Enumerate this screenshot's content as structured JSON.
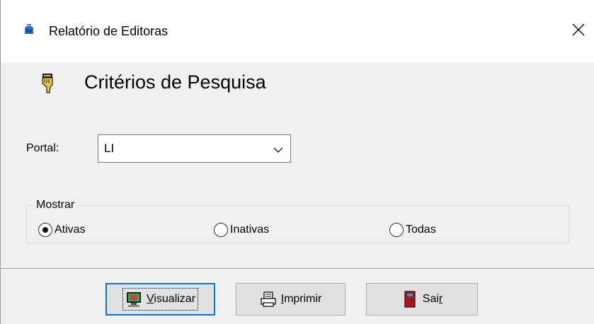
{
  "window": {
    "title": "Relatório de Editoras",
    "close_glyph": "✕"
  },
  "header": {
    "title": "Critérios de Pesquisa",
    "icon": "hand-pointing-icon"
  },
  "form": {
    "portal_label": "Portal:",
    "portal_value": "LI"
  },
  "filter": {
    "group_label": "Mostrar",
    "options": [
      {
        "label": "Ativas",
        "selected": true
      },
      {
        "label": "Inativas",
        "selected": false
      },
      {
        "label": "Todas",
        "selected": false
      }
    ]
  },
  "buttons": {
    "visualizar": {
      "mnemonic": "V",
      "rest": "isualizar",
      "icon": "monitor-icon"
    },
    "imprimir": {
      "mnemonic": "I",
      "rest": "mprimir",
      "icon": "printer-icon"
    },
    "sair": {
      "before": "Sai",
      "mnemonic": "r",
      "icon": "door-icon"
    }
  },
  "colors": {
    "default_button_border": "#0078d7",
    "window_background": "#f0f0f0"
  }
}
